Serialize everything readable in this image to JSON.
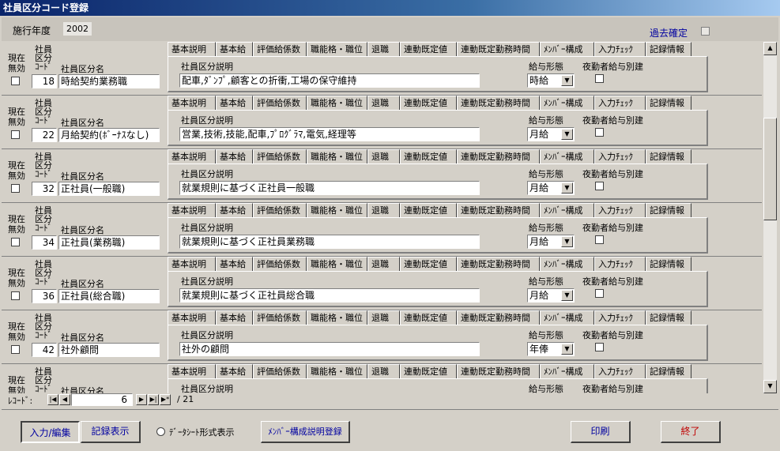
{
  "window": {
    "title": "社員区分コード登録"
  },
  "header": {
    "year_label": "施行年度",
    "year_value": "2002",
    "past_confirm_label": "過去確定"
  },
  "tabs": [
    "基本説明",
    "基本給",
    "評価給係数",
    "職能格・職位",
    "退職",
    "連動既定値",
    "連動既定勤務時間",
    "ﾒﾝﾊﾞｰ構成",
    "入力ﾁｪｯｸ",
    "記録情報"
  ],
  "row_labels": {
    "invalid": [
      "現在",
      "無効"
    ],
    "code": [
      "社員",
      "区分",
      "ｺｰﾄﾞ"
    ],
    "name": "社員区分名",
    "desc": "社員区分説明",
    "pay": "給与形態",
    "night": "夜勤者給与別建"
  },
  "records": [
    {
      "code": "18",
      "name": "時給契約業務職",
      "desc": "配車,ﾀﾞﾝﾌﾟ,顧客との折衝,工場の保守維持",
      "pay": "時給"
    },
    {
      "code": "22",
      "name": "月給契約(ﾎﾞｰﾅｽなし)",
      "desc": "営業,技術,技能,配車,ﾌﾟﾛｸﾞﾗﾏ,電気,経理等",
      "pay": "月給"
    },
    {
      "code": "32",
      "name": "正社員(一般職)",
      "desc": "就業規則に基づく正社員一般職",
      "pay": "月給"
    },
    {
      "code": "34",
      "name": "正社員(業務職)",
      "desc": "就業規則に基づく正社員業務職",
      "pay": "月給"
    },
    {
      "code": "36",
      "name": "正社員(総合職)",
      "desc": "就業規則に基づく正社員総合職",
      "pay": "月給"
    },
    {
      "code": "42",
      "name": "社外顧問",
      "desc": "社外の顧問",
      "pay": "年俸"
    },
    {
      "code": "",
      "name": "",
      "desc": "",
      "pay": ""
    }
  ],
  "navigation": {
    "record_label": "ﾚｺｰﾄﾞ:",
    "current": "6",
    "total": "/ 21"
  },
  "footer": {
    "input_edit": "入力/編集",
    "record_view": "記録表示",
    "datasheet_label": "ﾃﾞｰﾀｼｰﾄ形式表示",
    "member_register": "ﾒﾝﾊﾞｰ構成説明登録",
    "print": "印刷",
    "exit": "終了"
  },
  "colors": {
    "title_start": "#0a246a",
    "title_end": "#a6caf0",
    "exit_text": "#c00000",
    "link_blue": "#0000a0"
  }
}
